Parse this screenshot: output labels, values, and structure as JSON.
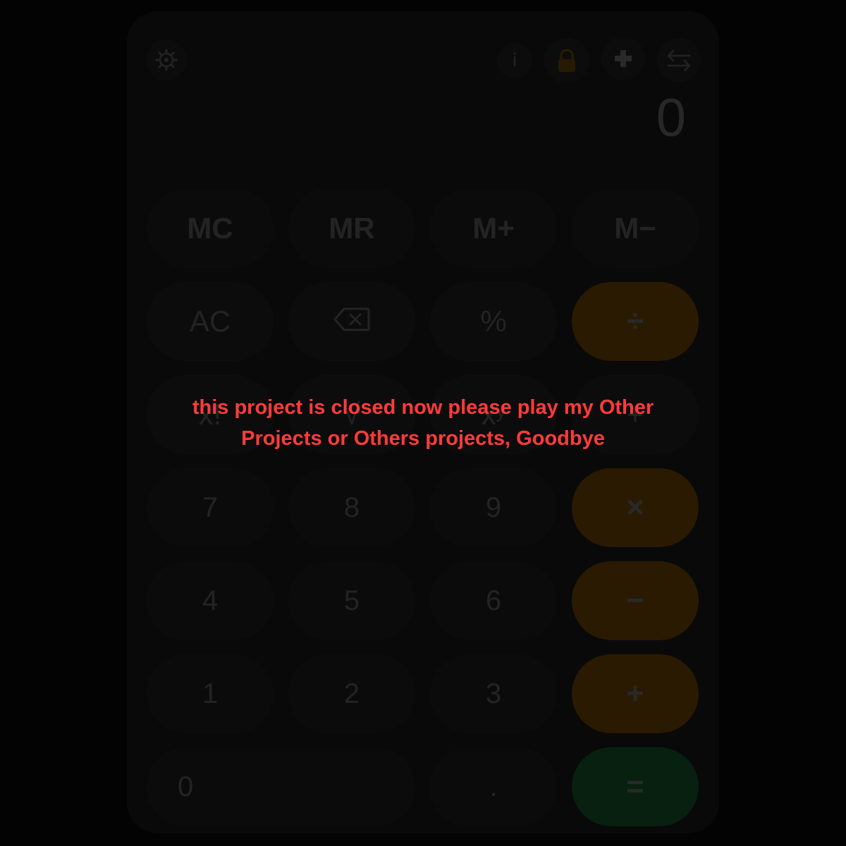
{
  "toolbar": {
    "settings_icon": "gear-icon",
    "info_label": "i",
    "lock_icon": "lock-icon",
    "plus_icon": "plus-icon",
    "swap_icon": "swap-arrows-icon"
  },
  "display": {
    "value": "0"
  },
  "keys": {
    "memory": [
      "MC",
      "MR",
      "M+",
      "M−"
    ],
    "ac": "AC",
    "backspace_icon": "backspace-icon",
    "percent": "%",
    "divide": "÷",
    "hidden_row": [
      "x!",
      "√",
      "xʸ",
      "+"
    ],
    "seven": "7",
    "eight": "8",
    "nine": "9",
    "multiply": "×",
    "four": "4",
    "five": "5",
    "six": "6",
    "minus": "−",
    "one": "1",
    "two": "2",
    "three": "3",
    "plus": "+",
    "zero": "0",
    "decimal": ".",
    "equals": "="
  },
  "overlay": {
    "message": "this project is closed now please play my Other Projects or Others projects, Goodbye"
  },
  "colors": {
    "operator": "#ff9f0a",
    "equals": "#30c85e",
    "message": "#ff3b3b"
  }
}
